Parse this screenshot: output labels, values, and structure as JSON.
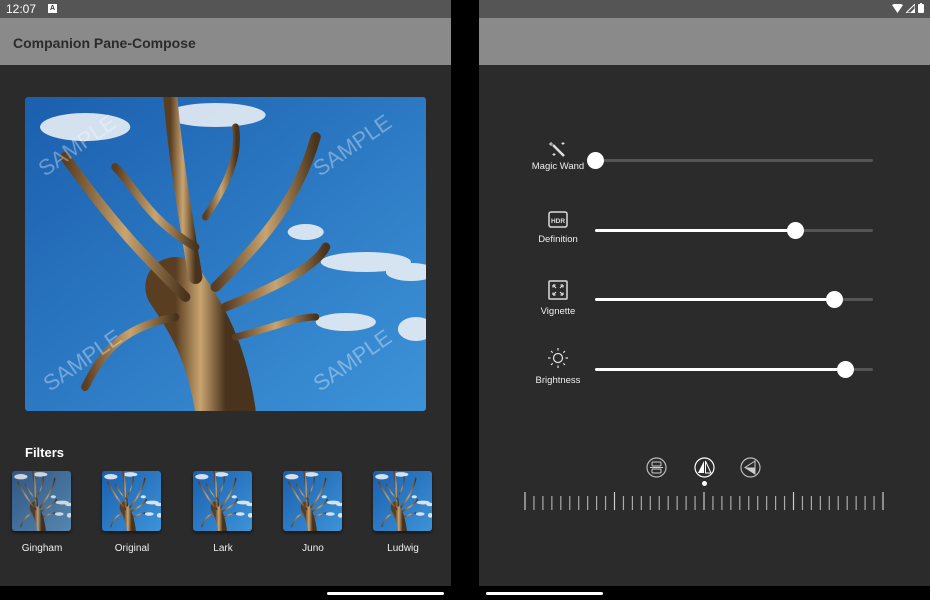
{
  "status_bar": {
    "time": "12:07",
    "notification_icon": "a-icon",
    "icons": [
      "wifi-icon",
      "signal-icon",
      "battery-icon"
    ]
  },
  "app_bar": {
    "title": "Companion Pane-Compose"
  },
  "hero": {
    "watermark": "SAMPLE"
  },
  "filters": {
    "heading": "Filters",
    "items": [
      {
        "label": "Gingham"
      },
      {
        "label": "Original"
      },
      {
        "label": "Lark"
      },
      {
        "label": "Juno"
      },
      {
        "label": "Ludwig"
      }
    ]
  },
  "controls": [
    {
      "label": "Magic Wand",
      "icon": "magic-wand-icon",
      "value": 0.0
    },
    {
      "label": "Definition",
      "icon": "hdr-icon",
      "value": 0.72
    },
    {
      "label": "Vignette",
      "icon": "vignette-icon",
      "value": 0.86
    },
    {
      "label": "Brightness",
      "icon": "brightness-icon",
      "value": 0.9
    }
  ],
  "modes": [
    {
      "icon": "flip-vertical-icon",
      "selected": false
    },
    {
      "icon": "flip-horizontal-icon",
      "selected": true
    },
    {
      "icon": "perspective-icon",
      "selected": false
    }
  ],
  "ruler": {
    "ticks": 41,
    "major_every": 10
  },
  "colors": {
    "background": "#2b2b2b",
    "app_bar": "#8a8a8a",
    "status_bar": "#555555",
    "accent": "#ffffff"
  }
}
